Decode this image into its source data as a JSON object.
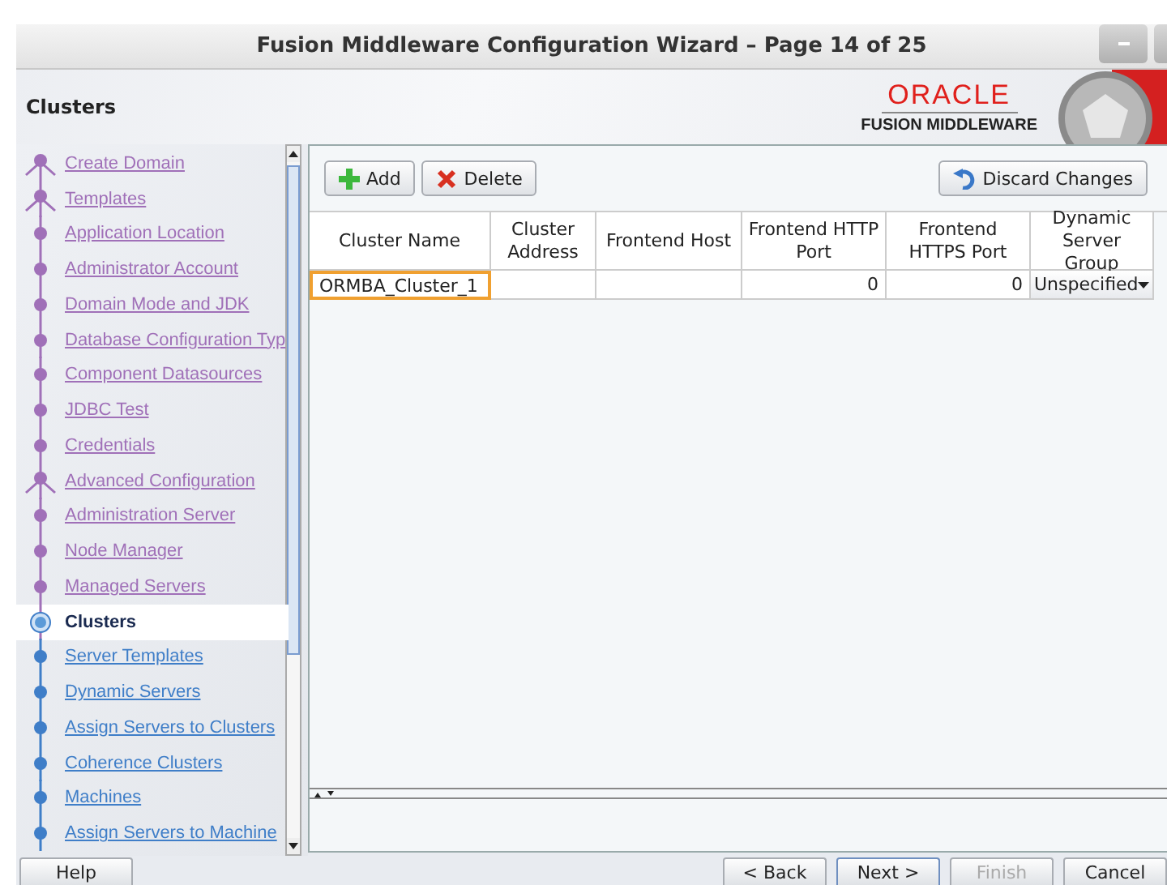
{
  "window": {
    "title": "Fusion Middleware Configuration Wizard – Page 14 of 25"
  },
  "header": {
    "page_title": "Clusters",
    "brand": "ORACLE",
    "product": "FUSION MIDDLEWARE"
  },
  "steps": [
    {
      "label": "Create Domain",
      "kind": "branch",
      "visited": true,
      "selected": false
    },
    {
      "label": "Templates",
      "kind": "branch",
      "visited": true,
      "selected": false
    },
    {
      "label": "Application Location",
      "kind": "step",
      "visited": true,
      "selected": false
    },
    {
      "label": "Administrator Account",
      "kind": "step",
      "visited": true,
      "selected": false
    },
    {
      "label": "Domain Mode and JDK",
      "kind": "step",
      "visited": true,
      "selected": false
    },
    {
      "label": "Database Configuration Typ",
      "kind": "step",
      "visited": true,
      "selected": false
    },
    {
      "label": "Component Datasources",
      "kind": "step",
      "visited": true,
      "selected": false
    },
    {
      "label": "JDBC Test",
      "kind": "step",
      "visited": true,
      "selected": false
    },
    {
      "label": "Credentials",
      "kind": "step",
      "visited": true,
      "selected": false
    },
    {
      "label": "Advanced Configuration",
      "kind": "branch",
      "visited": true,
      "selected": false
    },
    {
      "label": "Administration Server",
      "kind": "step",
      "visited": true,
      "selected": false
    },
    {
      "label": "Node Manager",
      "kind": "step",
      "visited": true,
      "selected": false
    },
    {
      "label": "Managed Servers",
      "kind": "step",
      "visited": true,
      "selected": false
    },
    {
      "label": "Clusters",
      "kind": "step",
      "visited": true,
      "selected": true
    },
    {
      "label": "Server Templates",
      "kind": "step",
      "visited": false,
      "selected": false
    },
    {
      "label": "Dynamic Servers",
      "kind": "step",
      "visited": false,
      "selected": false
    },
    {
      "label": "Assign Servers to Clusters",
      "kind": "step",
      "visited": false,
      "selected": false
    },
    {
      "label": "Coherence Clusters",
      "kind": "step",
      "visited": false,
      "selected": false
    },
    {
      "label": "Machines",
      "kind": "step",
      "visited": false,
      "selected": false
    },
    {
      "label": "Assign Servers to Machine",
      "kind": "step",
      "visited": false,
      "selected": false
    }
  ],
  "toolbar": {
    "add": "Add",
    "delete": "Delete",
    "discard": "Discard Changes"
  },
  "table": {
    "columns": [
      "Cluster Name",
      "Cluster Address",
      "Frontend Host",
      "Frontend HTTP Port",
      "Frontend HTTPS Port",
      "Dynamic Server Group"
    ],
    "rows": [
      {
        "name": "ORMBA_Cluster_1",
        "address": "",
        "host": "",
        "http_port": "0",
        "https_port": "0",
        "server_groups": "Unspecified",
        "selected": true
      }
    ]
  },
  "buttons": {
    "help": "Help",
    "back": "< Back",
    "next": "Next >",
    "finish": "Finish",
    "cancel": "Cancel",
    "finish_disabled": true
  }
}
